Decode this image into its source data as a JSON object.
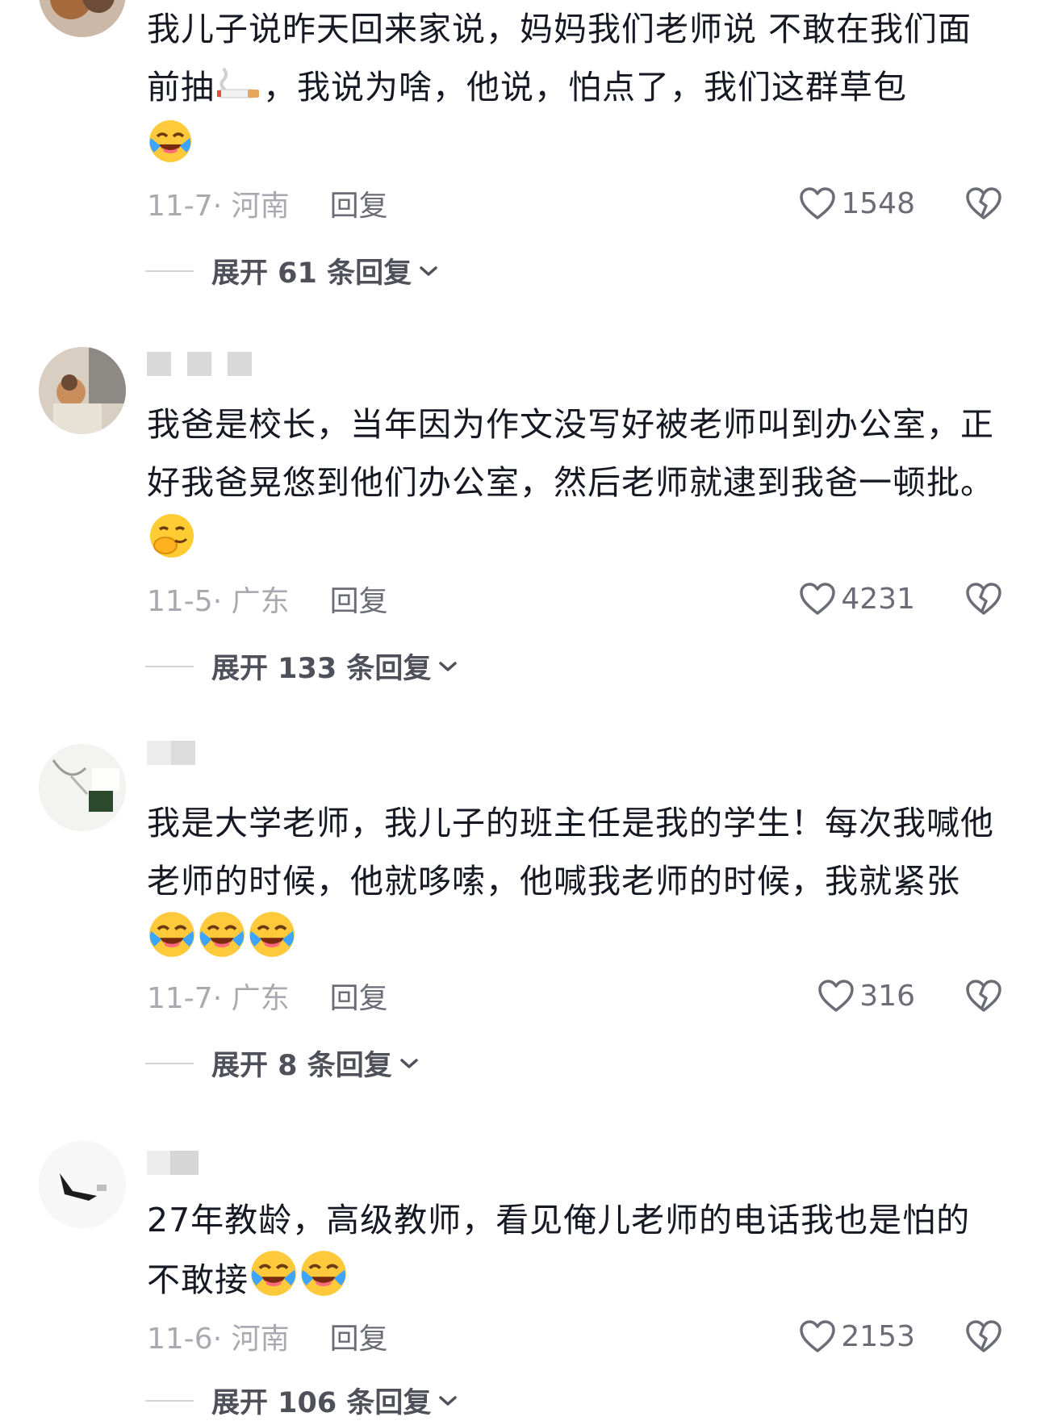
{
  "comments": [
    {
      "text_parts": [
        "我儿子说昨天回来家说，妈妈我们老师说 不敢在我们面前抽",
        "，我说为啥，他说，怕点了，我们这群草包"
      ],
      "emojis": [
        "cigarette-emoji",
        "crying-laughing-emoji"
      ],
      "date": "11-7",
      "location": "河南",
      "reply_label": "回复",
      "likes": "1548",
      "expand_label": "展开 61 条回复"
    },
    {
      "text_parts": [
        "我爸是校长，当年因为作文没写好被老师叫到办公室，正好我爸晃悠到他们办公室，然后老师就逮到我爸一顿批。"
      ],
      "emojis": [
        "hand-over-mouth-emoji"
      ],
      "date": "11-5",
      "location": "广东",
      "reply_label": "回复",
      "likes": "4231",
      "expand_label": "展开 133 条回复"
    },
    {
      "text_parts": [
        "我是大学老师，我儿子的班主任是我的学生！每次我喊他老师的时候，他就哆嗦，他喊我老师的时候，我就紧张"
      ],
      "emojis": [
        "crying-laughing-emoji",
        "crying-laughing-emoji",
        "crying-laughing-emoji"
      ],
      "date": "11-7",
      "location": "广东",
      "reply_label": "回复",
      "likes": "316",
      "expand_label": "展开 8 条回复"
    },
    {
      "text_parts": [
        "27年教龄，高级教师，看见俺儿老师的电话我也是怕的不敢接"
      ],
      "emojis": [
        "crying-laughing-emoji",
        "crying-laughing-emoji"
      ],
      "date": "11-6",
      "location": "河南",
      "reply_label": "回复",
      "likes": "2153",
      "expand_label": "展开 106 条回复"
    }
  ],
  "colors": {
    "text": "#161823",
    "meta": "#a9aab0",
    "reply": "#6b6c75",
    "expand": "#4f505a"
  }
}
